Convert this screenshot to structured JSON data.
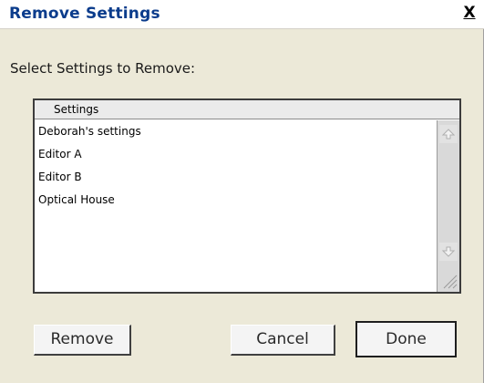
{
  "window": {
    "title": "Remove Settings",
    "close_label": "X"
  },
  "prompt": "Select Settings to Remove:",
  "list": {
    "header": "Settings",
    "items": [
      "Deborah's settings",
      "Editor A",
      "Editor B",
      "Optical House"
    ]
  },
  "buttons": {
    "remove": "Remove",
    "cancel": "Cancel",
    "done": "Done"
  },
  "colors": {
    "title_text": "#0b3c8c",
    "dialog_bg": "#ece9d8"
  },
  "icons": {
    "scroll_up": "scroll-up-arrow-icon",
    "scroll_down": "scroll-down-arrow-icon",
    "resize": "resize-grip-icon"
  }
}
